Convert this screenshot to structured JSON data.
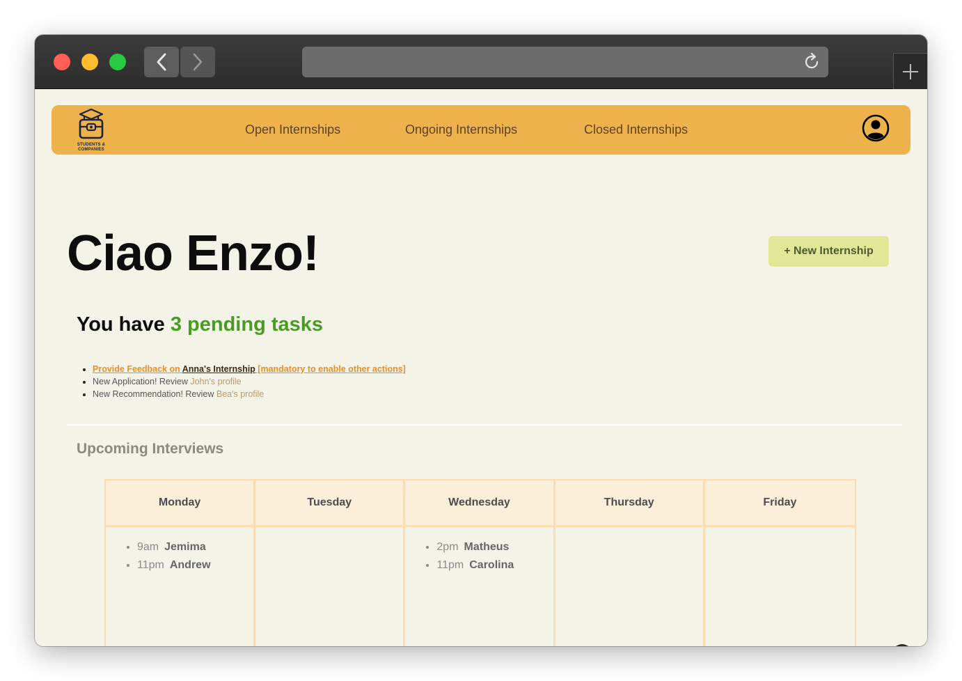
{
  "nav": {
    "logo_line1": "STUDENTS &",
    "logo_line2": "COMPANIES",
    "links": [
      "Open Internships",
      "Ongoing Internships",
      "Closed Internships"
    ]
  },
  "main": {
    "greeting": "Ciao Enzo!",
    "new_button": "+ New Internship",
    "pending_prefix": "You have ",
    "pending_count": "3 pending tasks",
    "tasks": {
      "t1_a": "Provide Feedback on ",
      "t1_b": "Anna's Internship",
      "t1_c": " [mandatory to enable other actions]",
      "t2_a": "New Application! Review ",
      "t2_b": "John's profile",
      "t3_a": "New Recommendation! Review ",
      "t3_b": "Bea's profile"
    }
  },
  "interviews": {
    "title": "Upcoming Interviews",
    "days": [
      {
        "name": "Monday",
        "items": [
          {
            "time": "9am",
            "person": "Jemima"
          },
          {
            "time": "11pm",
            "person": "Andrew"
          }
        ]
      },
      {
        "name": "Tuesday",
        "items": []
      },
      {
        "name": "Wednesday",
        "items": [
          {
            "time": "2pm",
            "person": "Matheus"
          },
          {
            "time": "11pm",
            "person": "Carolina"
          }
        ]
      },
      {
        "name": "Thursday",
        "items": []
      },
      {
        "name": "Friday",
        "items": []
      }
    ]
  },
  "colors": {
    "nav_bg": "#edb24c",
    "page_bg": "#f4f3e8",
    "accent_green": "#4a9a26",
    "button_bg": "#e0e897",
    "link_orange": "#e68f2b",
    "calendar_border": "#fbdcb1"
  },
  "icons": {
    "back": "chevron-left-icon",
    "forward": "chevron-right-icon",
    "reload": "reload-icon",
    "new_tab": "plus-icon",
    "profile": "user-circle-icon",
    "logo": "graduation-briefcase-icon",
    "support": "support-agent-icon"
  }
}
